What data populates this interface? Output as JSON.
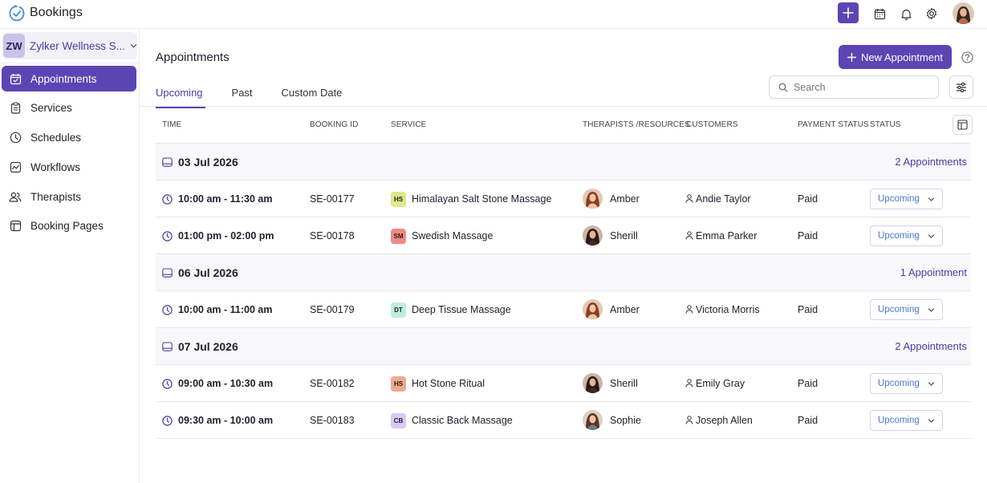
{
  "app": {
    "title": "Bookings"
  },
  "org": {
    "initials": "ZW",
    "name": "Zylker Wellness S..."
  },
  "sidebar": {
    "items": [
      {
        "label": "Appointments",
        "icon": "calendar-check-icon",
        "active": true
      },
      {
        "label": "Services",
        "icon": "clipboard-icon",
        "active": false
      },
      {
        "label": "Schedules",
        "icon": "clock-icon",
        "active": false
      },
      {
        "label": "Workflows",
        "icon": "workflow-icon",
        "active": false
      },
      {
        "label": "Therapists",
        "icon": "users-icon",
        "active": false
      },
      {
        "label": "Booking Pages",
        "icon": "layout-icon",
        "active": false
      }
    ]
  },
  "main": {
    "title": "Appointments",
    "new_button": "New Appointment",
    "tabs": [
      "Upcoming",
      "Past",
      "Custom Date"
    ],
    "search_placeholder": "Search",
    "columns": [
      "TIME",
      "BOOKING ID",
      "SERVICE",
      "THERAPISTS /RESOURCES",
      "CUSTOMERS",
      "PAYMENT STATUS",
      "STATUS"
    ]
  },
  "groups": [
    {
      "date": "03 Jul 2026",
      "count": "2 Appointments",
      "rows": [
        {
          "time": "10:00 am - 11:30 am",
          "booking_id": "SE-00177",
          "badge": "HS",
          "badge_color": "#dde88a",
          "service": "Himalayan Salt Stone Massage",
          "therapist": "Amber",
          "customer": "Andie Taylor",
          "payment": "Paid",
          "status": "Upcoming"
        },
        {
          "time": "01:00 pm - 02:00 pm",
          "booking_id": "SE-00178",
          "badge": "SM",
          "badge_color": "#f08a86",
          "service": "Swedish Massage",
          "therapist": "Sherill",
          "customer": "Emma Parker",
          "payment": "Paid",
          "status": "Upcoming"
        }
      ]
    },
    {
      "date": "06 Jul 2026",
      "count": "1 Appointment",
      "rows": [
        {
          "time": "10:00 am - 11:00 am",
          "booking_id": "SE-00179",
          "badge": "DT",
          "badge_color": "#bfeedd",
          "service": "Deep Tissue Massage",
          "therapist": "Amber",
          "customer": "Victoria Morris",
          "payment": "Paid",
          "status": "Upcoming"
        }
      ]
    },
    {
      "date": "07 Jul 2026",
      "count": "2 Appointments",
      "rows": [
        {
          "time": "09:00 am - 10:30 am",
          "booking_id": "SE-00182",
          "badge": "HS",
          "badge_color": "#f0a98d",
          "service": "Hot Stone Ritual",
          "therapist": "Sherill",
          "customer": "Emily Gray",
          "payment": "Paid",
          "status": "Upcoming"
        },
        {
          "time": "09:30 am - 10:00 am",
          "booking_id": "SE-00183",
          "badge": "CB",
          "badge_color": "#d8c8f3",
          "service": "Classic Back Massage",
          "therapist": "Sophie",
          "customer": "Joseph Allen",
          "payment": "Paid",
          "status": "Upcoming"
        }
      ]
    }
  ],
  "colors": {
    "accent": "#5b45b3",
    "status_text": "#4a78c8"
  }
}
